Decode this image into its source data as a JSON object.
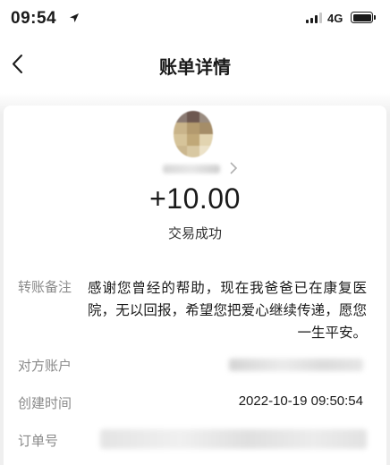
{
  "status_bar": {
    "time": "09:54",
    "network": "4G"
  },
  "nav": {
    "title": "账单详情"
  },
  "transaction": {
    "amount": "+10.00",
    "status": "交易成功"
  },
  "details": {
    "remark_label": "转账备注",
    "remark_text": "感谢您曾经的帮助，现在我爸爸已在康复医院，无以回报，希望您把爱心继续传递，愿您一生平安。",
    "counterparty_label": "对方账户",
    "created_label": "创建时间",
    "created_value": "2022-10-19 09:50:54",
    "order_label": "订单号"
  },
  "colors": {
    "label_gray": "#8a8a8a",
    "page_bg": "#efefef"
  },
  "icons": [
    "location-arrow-icon",
    "signal-icon",
    "battery-icon",
    "back-chevron-icon",
    "chevron-right-icon"
  ]
}
